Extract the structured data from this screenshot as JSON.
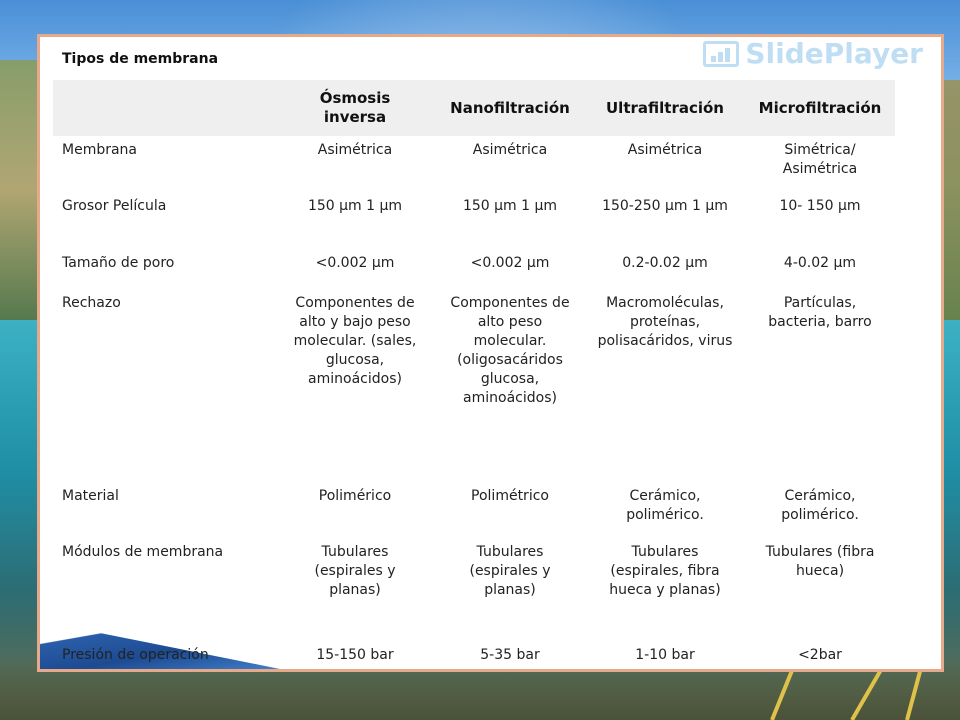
{
  "slide": {
    "title": "Tipos de membrana",
    "logo_text": "SlidePlayer"
  },
  "columns": [
    "Ósmosis inversa",
    "Nanofiltración",
    "Ultrafiltración",
    "Microfiltración"
  ],
  "rows": [
    {
      "label": "Membrana",
      "cells": [
        "Asimétrica",
        "Asimétrica",
        "Asimétrica",
        "Simétrica/ Asimétrica"
      ]
    },
    {
      "label": "Grosor Película",
      "cells": [
        "150 µm 1 µm",
        "150 µm 1 µm",
        "150-250 µm 1 µm",
        "10- 150 µm"
      ]
    },
    {
      "label": "Tamaño de poro",
      "cells": [
        "<0.002 µm",
        "<0.002 µm",
        "0.2-0.02 µm",
        "4-0.02 µm"
      ]
    },
    {
      "label": "Rechazo",
      "cells": [
        "Componentes de alto y bajo peso molecular. (sales, glucosa, aminoácidos)",
        "Componentes de alto peso molecular. (oligosacáridos glucosa, aminoácidos)",
        "Macromoléculas, proteínas, polisacáridos, virus",
        "Partículas, bacteria, barro"
      ]
    },
    {
      "label": "Material",
      "cells": [
        "Polimérico",
        "Polimétrico",
        "Cerámico, polimérico.",
        "Cerámico, polimérico."
      ]
    },
    {
      "label": "Módulos de membrana",
      "cells": [
        "Tubulares (espirales y planas)",
        "Tubulares (espirales y planas)",
        "Tubulares (espirales, fibra hueca y planas)",
        "Tubulares (fibra hueca)"
      ]
    },
    {
      "label": "Presión de operación",
      "cells": [
        "15-150 bar",
        "5-35 bar",
        "1-10 bar",
        "<2bar"
      ]
    }
  ],
  "colors": {
    "border": "#e6a98a",
    "header_band": "#efefef",
    "logo": "#4aa3df"
  }
}
